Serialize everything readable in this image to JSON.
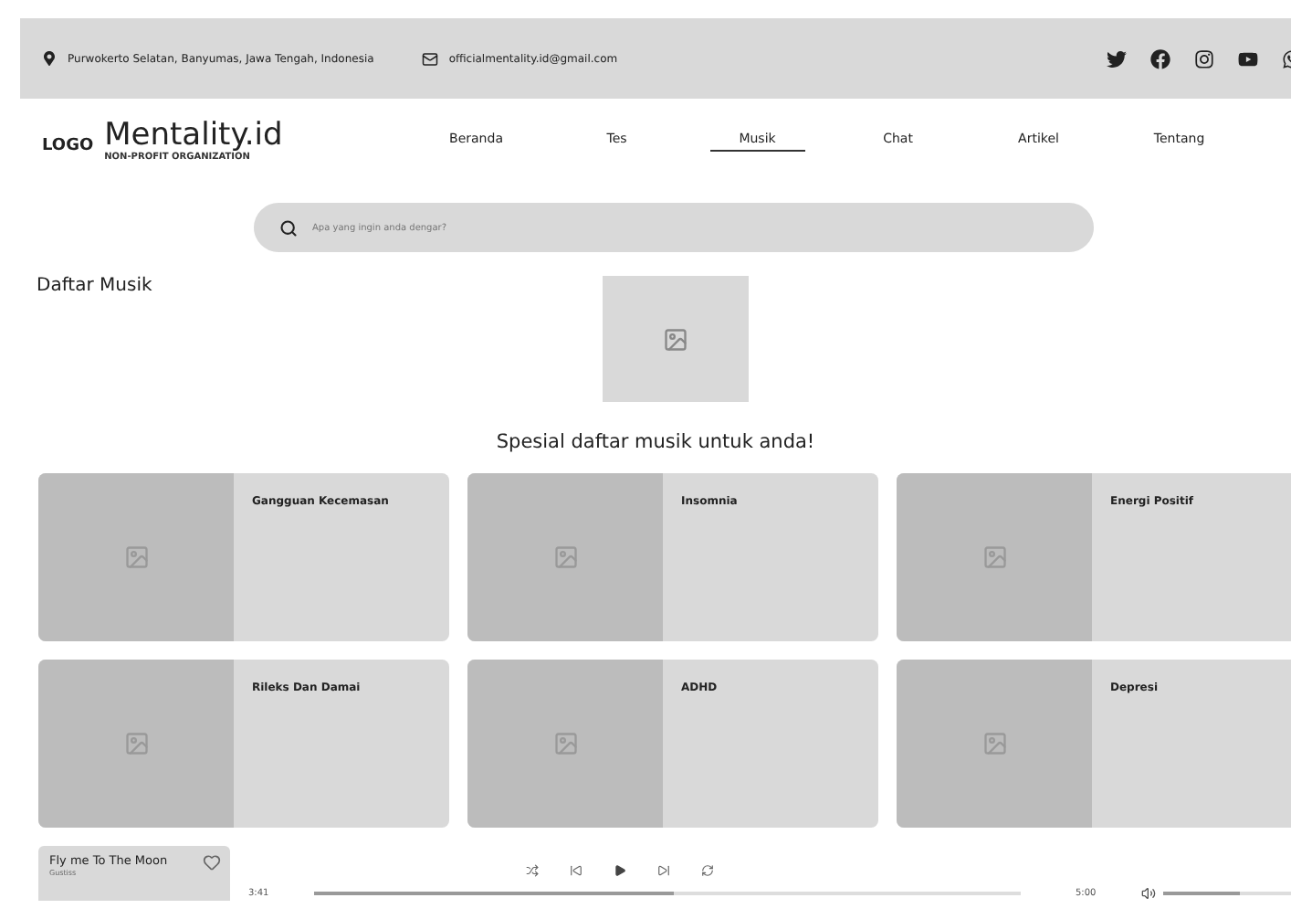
{
  "top_bar": {
    "address": "Purwokerto Selatan, Banyumas, Jawa Tengah, Indonesia",
    "email": "officialmentality.id@gmail.com",
    "socials": [
      {
        "kind": "twitter"
      },
      {
        "kind": "facebook"
      },
      {
        "kind": "instagram"
      },
      {
        "kind": "youtube"
      },
      {
        "kind": "whatsapp"
      }
    ]
  },
  "header": {
    "logo": "LOGO",
    "brand": "Mentality.id",
    "tagline": "NON-PROFIT ORGANIZATION",
    "nav": [
      {
        "label": "Beranda",
        "selected": false
      },
      {
        "label": "Tes",
        "selected": false
      },
      {
        "label": "Musik",
        "selected": true
      },
      {
        "label": "Chat",
        "selected": false
      },
      {
        "label": "Artikel",
        "selected": false
      },
      {
        "label": "Tentang",
        "selected": false
      }
    ]
  },
  "search": {
    "placeholder": "Apa yang ingin anda dengar?"
  },
  "section_title": "Daftar Musik",
  "heading": "Spesial daftar musik untuk anda!",
  "playlists": [
    {
      "title": "Gangguan Kecemasan"
    },
    {
      "title": "Insomnia"
    },
    {
      "title": "Energi Positif"
    },
    {
      "title": "Rileks Dan Damai"
    },
    {
      "title": "ADHD"
    },
    {
      "title": "Depresi"
    }
  ],
  "player": {
    "song": "Fly me To The Moon",
    "artist": "Gustiss",
    "elapsed": "3:41",
    "duration": "5:00",
    "level": 0.51,
    "volume": {
      "level": 0.6
    }
  }
}
